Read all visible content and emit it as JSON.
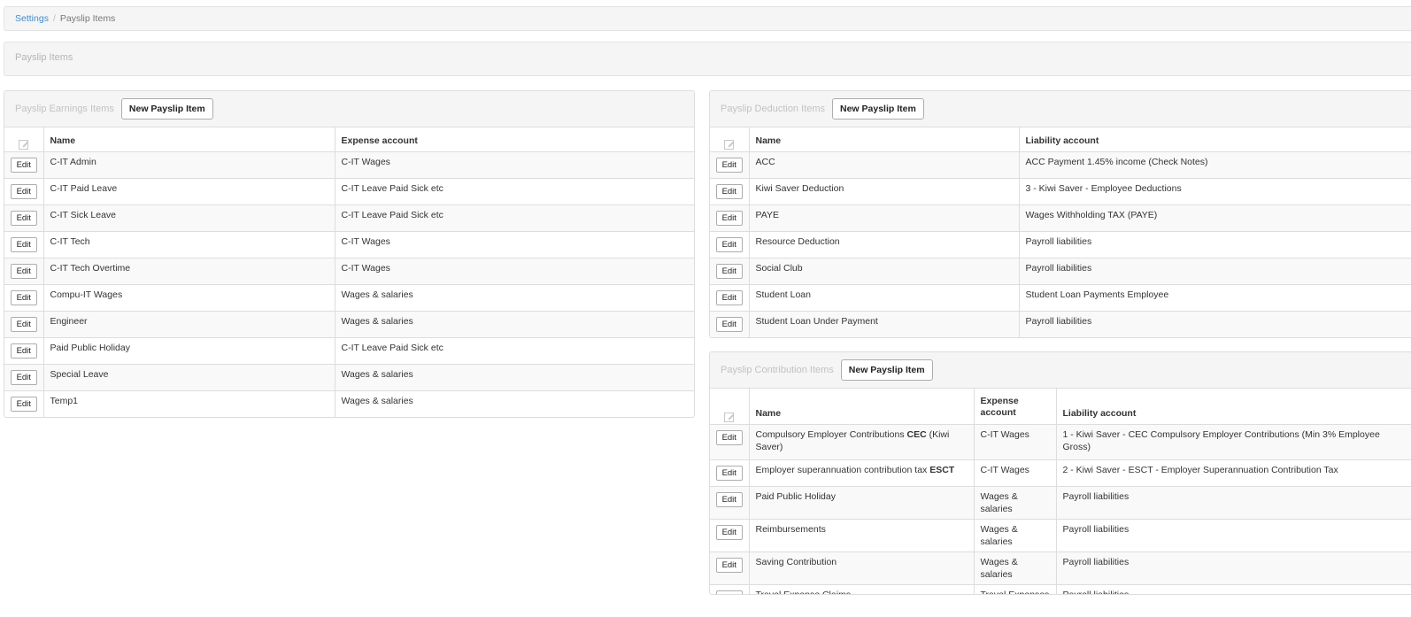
{
  "breadcrumb": {
    "link": "Settings",
    "separator": "/",
    "current": "Payslip Items"
  },
  "page_header": {
    "title": "Payslip Items"
  },
  "earnings": {
    "title": "Payslip Earnings Items",
    "new_button": "New Payslip Item",
    "col_name": "Name",
    "col_account": "Expense account",
    "edit_label": "Edit",
    "rows": [
      {
        "name": "C-IT Admin",
        "account": "C-IT Wages"
      },
      {
        "name": "C-IT Paid Leave",
        "account": "C-IT Leave Paid Sick etc"
      },
      {
        "name": "C-IT Sick Leave",
        "account": "C-IT Leave Paid Sick etc"
      },
      {
        "name": "C-IT Tech",
        "account": "C-IT Wages"
      },
      {
        "name": "C-IT Tech Overtime",
        "account": "C-IT Wages"
      },
      {
        "name": "Compu-IT Wages",
        "account": "Wages & salaries"
      },
      {
        "name": "Engineer",
        "account": "Wages & salaries"
      },
      {
        "name": "Paid Public Holiday",
        "account": "C-IT Leave Paid Sick etc"
      },
      {
        "name": "Special Leave",
        "account": "Wages & salaries"
      },
      {
        "name": "Temp1",
        "account": "Wages & salaries"
      }
    ]
  },
  "deductions": {
    "title": "Payslip Deduction Items",
    "new_button": "New Payslip Item",
    "col_name": "Name",
    "col_account": "Liability account",
    "edit_label": "Edit",
    "rows": [
      {
        "name": "ACC",
        "account": "ACC Payment 1.45% income (Check Notes)"
      },
      {
        "name": "Kiwi Saver Deduction",
        "account": "3 - Kiwi Saver - Employee Deductions"
      },
      {
        "name": "PAYE",
        "account": "Wages Withholding TAX (PAYE)"
      },
      {
        "name": "Resource Deduction",
        "account": "Payroll liabilities"
      },
      {
        "name": "Social Club",
        "account": "Payroll liabilities"
      },
      {
        "name": "Student Loan",
        "account": "Student Loan Payments Employee"
      },
      {
        "name": "Student Loan Under Payment",
        "account": "Payroll liabilities"
      }
    ]
  },
  "contributions": {
    "title": "Payslip Contribution Items",
    "new_button": "New Payslip Item",
    "col_name": "Name",
    "col_expense": "Expense account",
    "col_liability": "Liability account",
    "edit_label": "Edit",
    "rows": [
      {
        "name_pre": "Compulsory Employer Contributions ",
        "name_bold": "CEC",
        "name_post": " (Kiwi Saver)",
        "expense": "C-IT Wages",
        "liability": "1 - Kiwi Saver - CEC Compulsory Employer Contributions (Min 3% Employee Gross)"
      },
      {
        "name_pre": "Employer superannuation contribution tax ",
        "name_bold": "ESCT",
        "name_post": "",
        "expense": "C-IT Wages",
        "liability": "2 - Kiwi Saver - ESCT - Employer Superannuation Contribution Tax"
      },
      {
        "name_pre": "Paid Public Holiday",
        "name_bold": "",
        "name_post": "",
        "expense": "Wages & salaries",
        "liability": "Payroll liabilities"
      },
      {
        "name_pre": "Reimbursements",
        "name_bold": "",
        "name_post": "",
        "expense": "Wages & salaries",
        "liability": "Payroll liabilities"
      },
      {
        "name_pre": "Saving Contribution",
        "name_bold": "",
        "name_post": "",
        "expense": "Wages & salaries",
        "liability": "Payroll liabilities"
      },
      {
        "name_pre": "Travel Expense Claims",
        "name_bold": "",
        "name_post": "",
        "expense": "Travel Expenses",
        "liability": "Payroll liabilities"
      }
    ]
  }
}
